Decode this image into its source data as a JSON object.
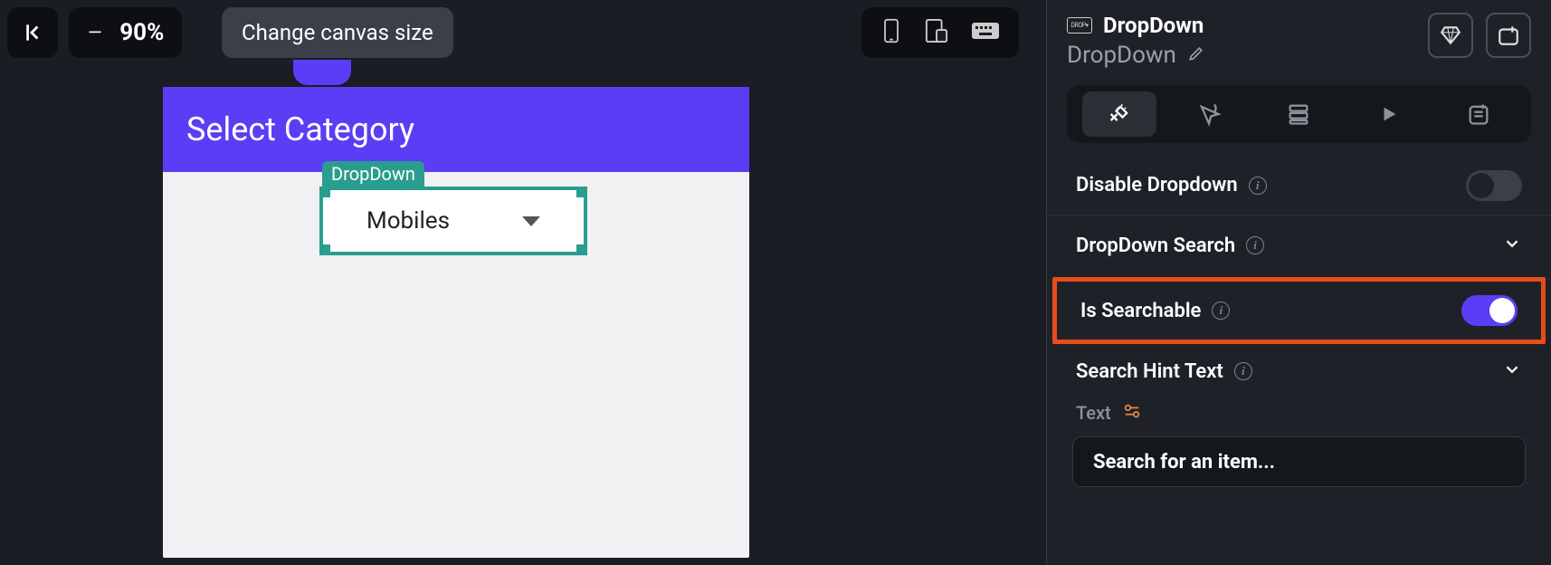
{
  "toolbar": {
    "zoom_level": "90%",
    "tooltip": "Change canvas size"
  },
  "canvas": {
    "header_title": "Select Category",
    "widget_label": "DropDown",
    "dropdown_selected": "Mobiles"
  },
  "panel": {
    "type_label": "DropDown",
    "instance_name": "DropDown",
    "properties": {
      "disable_dropdown": {
        "label": "Disable Dropdown",
        "value": false
      },
      "dropdown_search": {
        "label": "DropDown Search"
      },
      "is_searchable": {
        "label": "Is Searchable",
        "value": true
      },
      "search_hint_text": {
        "label": "Search Hint Text"
      },
      "text_sublabel": "Text",
      "search_hint_value": "Search for an item..."
    }
  }
}
